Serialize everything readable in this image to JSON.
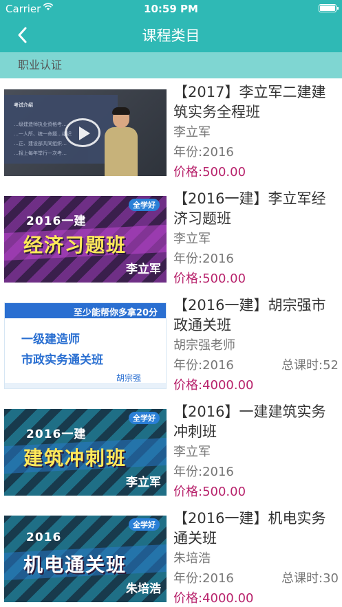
{
  "status_bar": {
    "carrier": "Carrier",
    "wifi_icon": "wifi-icon",
    "time": "10:59 PM",
    "battery_icon": "battery-icon",
    "battery_level": 1.0
  },
  "nav": {
    "title": "课程类目",
    "back_icon": "chevron-left-icon"
  },
  "section": {
    "label": "职业认证"
  },
  "courses": [
    {
      "title": "【2017】李立军二建建筑实务全程班",
      "teacher": "李立军",
      "year": "年份:2016",
      "lessons": "",
      "price": "价格:500.00",
      "thumb": {
        "style": "video",
        "text_lines": [
          "考试介绍",
          "…级建造师执业资格考…",
          "…一人所、统一命题…组织",
          "…正、建设部共同组织…",
          "…报上每年举行一次考…"
        ]
      }
    },
    {
      "title": "【2016一建】李立军经济习题班",
      "teacher": "李立军",
      "year": "年份:2016",
      "lessons": "",
      "price": "价格:500.00",
      "thumb": {
        "style": "banner-purple",
        "logo": "全学好",
        "year": "2016一建",
        "main": "经济习题班",
        "teacher": "李立军"
      }
    },
    {
      "title": "【2016一建】胡宗强市政通关班",
      "teacher": "胡宗强老师",
      "year": "年份:2016",
      "lessons": "总课时:52",
      "price": "价格:4000.00",
      "thumb": {
        "style": "white",
        "top": "至少能帮你多拿20分",
        "line1": "一级建造师",
        "line2": "市政实务通关班",
        "teacher": "胡宗强"
      }
    },
    {
      "title": "【2016】一建建筑实务冲刺班",
      "teacher": "李立军",
      "year": "年份:2016",
      "lessons": "",
      "price": "价格:500.00",
      "thumb": {
        "style": "banner-teal",
        "logo": "全学好",
        "year": "2016一建",
        "main": "建筑冲刺班",
        "teacher": "李立军"
      }
    },
    {
      "title": "【2016一建】机电实务通关班",
      "teacher": "朱培浩",
      "year": "年份:2016",
      "lessons": "总课时:30",
      "price": "价格:4000.00",
      "thumb": {
        "style": "banner-teal",
        "logo": "全学好",
        "year": "2016",
        "main": "机电通关班",
        "teacher": "朱培浩"
      }
    }
  ]
}
